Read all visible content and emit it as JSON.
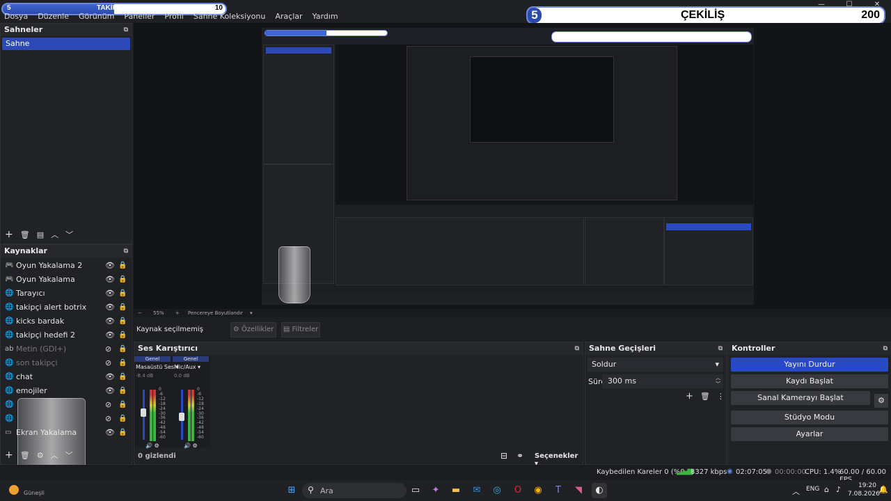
{
  "menu": {
    "items": [
      "Dosya",
      "Düzenle",
      "Görünüm",
      "Paneller",
      "Profil",
      "Sahne Koleksiyonu",
      "Araçlar",
      "Yardım"
    ]
  },
  "followers_goal": {
    "label": "TAKİPÇİLER",
    "current": "5",
    "target": "10",
    "progress": 0.5
  },
  "giveaway_goal": {
    "label": "ÇEKİLİŞ",
    "current": "5",
    "target": "200"
  },
  "scenes": {
    "title": "Sahneler",
    "items": [
      "Sahne"
    ]
  },
  "sources": {
    "title": "Kaynaklar",
    "items": [
      {
        "icon": "gamepad-icon",
        "label": "Oyun Yakalama 2",
        "visible": true
      },
      {
        "icon": "gamepad-icon",
        "label": "Oyun Yakalama",
        "visible": true
      },
      {
        "icon": "globe-icon",
        "label": "Tarayıcı",
        "visible": true
      },
      {
        "icon": "globe-icon",
        "label": "takipçi alert botrix",
        "visible": true
      },
      {
        "icon": "globe-icon",
        "label": "kicks bardak",
        "visible": true
      },
      {
        "icon": "globe-icon",
        "label": "takipçi hedefi 2",
        "visible": true
      },
      {
        "icon": "text-icon",
        "label": "Metin (GDI+)",
        "visible": false
      },
      {
        "icon": "globe-icon",
        "label": "son takipçi",
        "visible": false
      },
      {
        "icon": "globe-icon",
        "label": "chat",
        "visible": true
      },
      {
        "icon": "globe-icon",
        "label": "emojiler",
        "visible": true
      },
      {
        "icon": "globe-icon",
        "label": "",
        "visible": false
      },
      {
        "icon": "globe-icon",
        "label": "",
        "visible": false
      },
      {
        "icon": "monitor-icon",
        "label": "Ekran Yakalama",
        "visible": true
      }
    ]
  },
  "preview_toolbar": {
    "zoom": "55%",
    "resize_label": "Pencereye Boyutlandır"
  },
  "source_bar": {
    "no_source": "Kaynak seçilmemiş",
    "properties": "Özellikler",
    "filters": "Filtreler"
  },
  "mixer": {
    "title": "Ses Karıştırıcı",
    "channels": [
      {
        "tab": "Genel",
        "name": "Masaüstü Ses",
        "db": "-8.4 dB",
        "level": 0.55
      },
      {
        "tab": "Genel",
        "name": "Mic/Aux",
        "db": "0.0 dB",
        "level": 0.45
      }
    ],
    "scale": [
      "0",
      "-6",
      "-12",
      "-18",
      "-24",
      "-30",
      "-36",
      "-42",
      "-48",
      "-54",
      "-60"
    ],
    "hidden": "0 gizlendi",
    "options": "Seçenekler"
  },
  "transitions": {
    "title": "Sahne Geçişleri",
    "selected": "Soldur",
    "duration_label": "Süre",
    "duration_value": "300 ms"
  },
  "controls": {
    "title": "Kontroller",
    "stop_stream": "Yayını Durdur",
    "start_record": "Kaydı Başlat",
    "start_vcam": "Sanal Kamerayı Başlat",
    "studio_mode": "Stüdyo Modu",
    "settings": "Ayarlar"
  },
  "status": {
    "dropped": "Kaybedilen Kareler 0 (%0.0)",
    "bitrate": "8327 kbps",
    "stream_time": "02:07:05",
    "rec_time": "00:00:00",
    "cpu": "CPU: 1.4%",
    "fps": "60.00 / 60.00 FPS"
  },
  "taskbar": {
    "search_placeholder": "Ara",
    "time": "19:20",
    "date": "7.08.2026",
    "weather": "Güneşli"
  },
  "colors": {
    "accent": "#2a49c5",
    "goal_fill": "#3f66d2"
  }
}
